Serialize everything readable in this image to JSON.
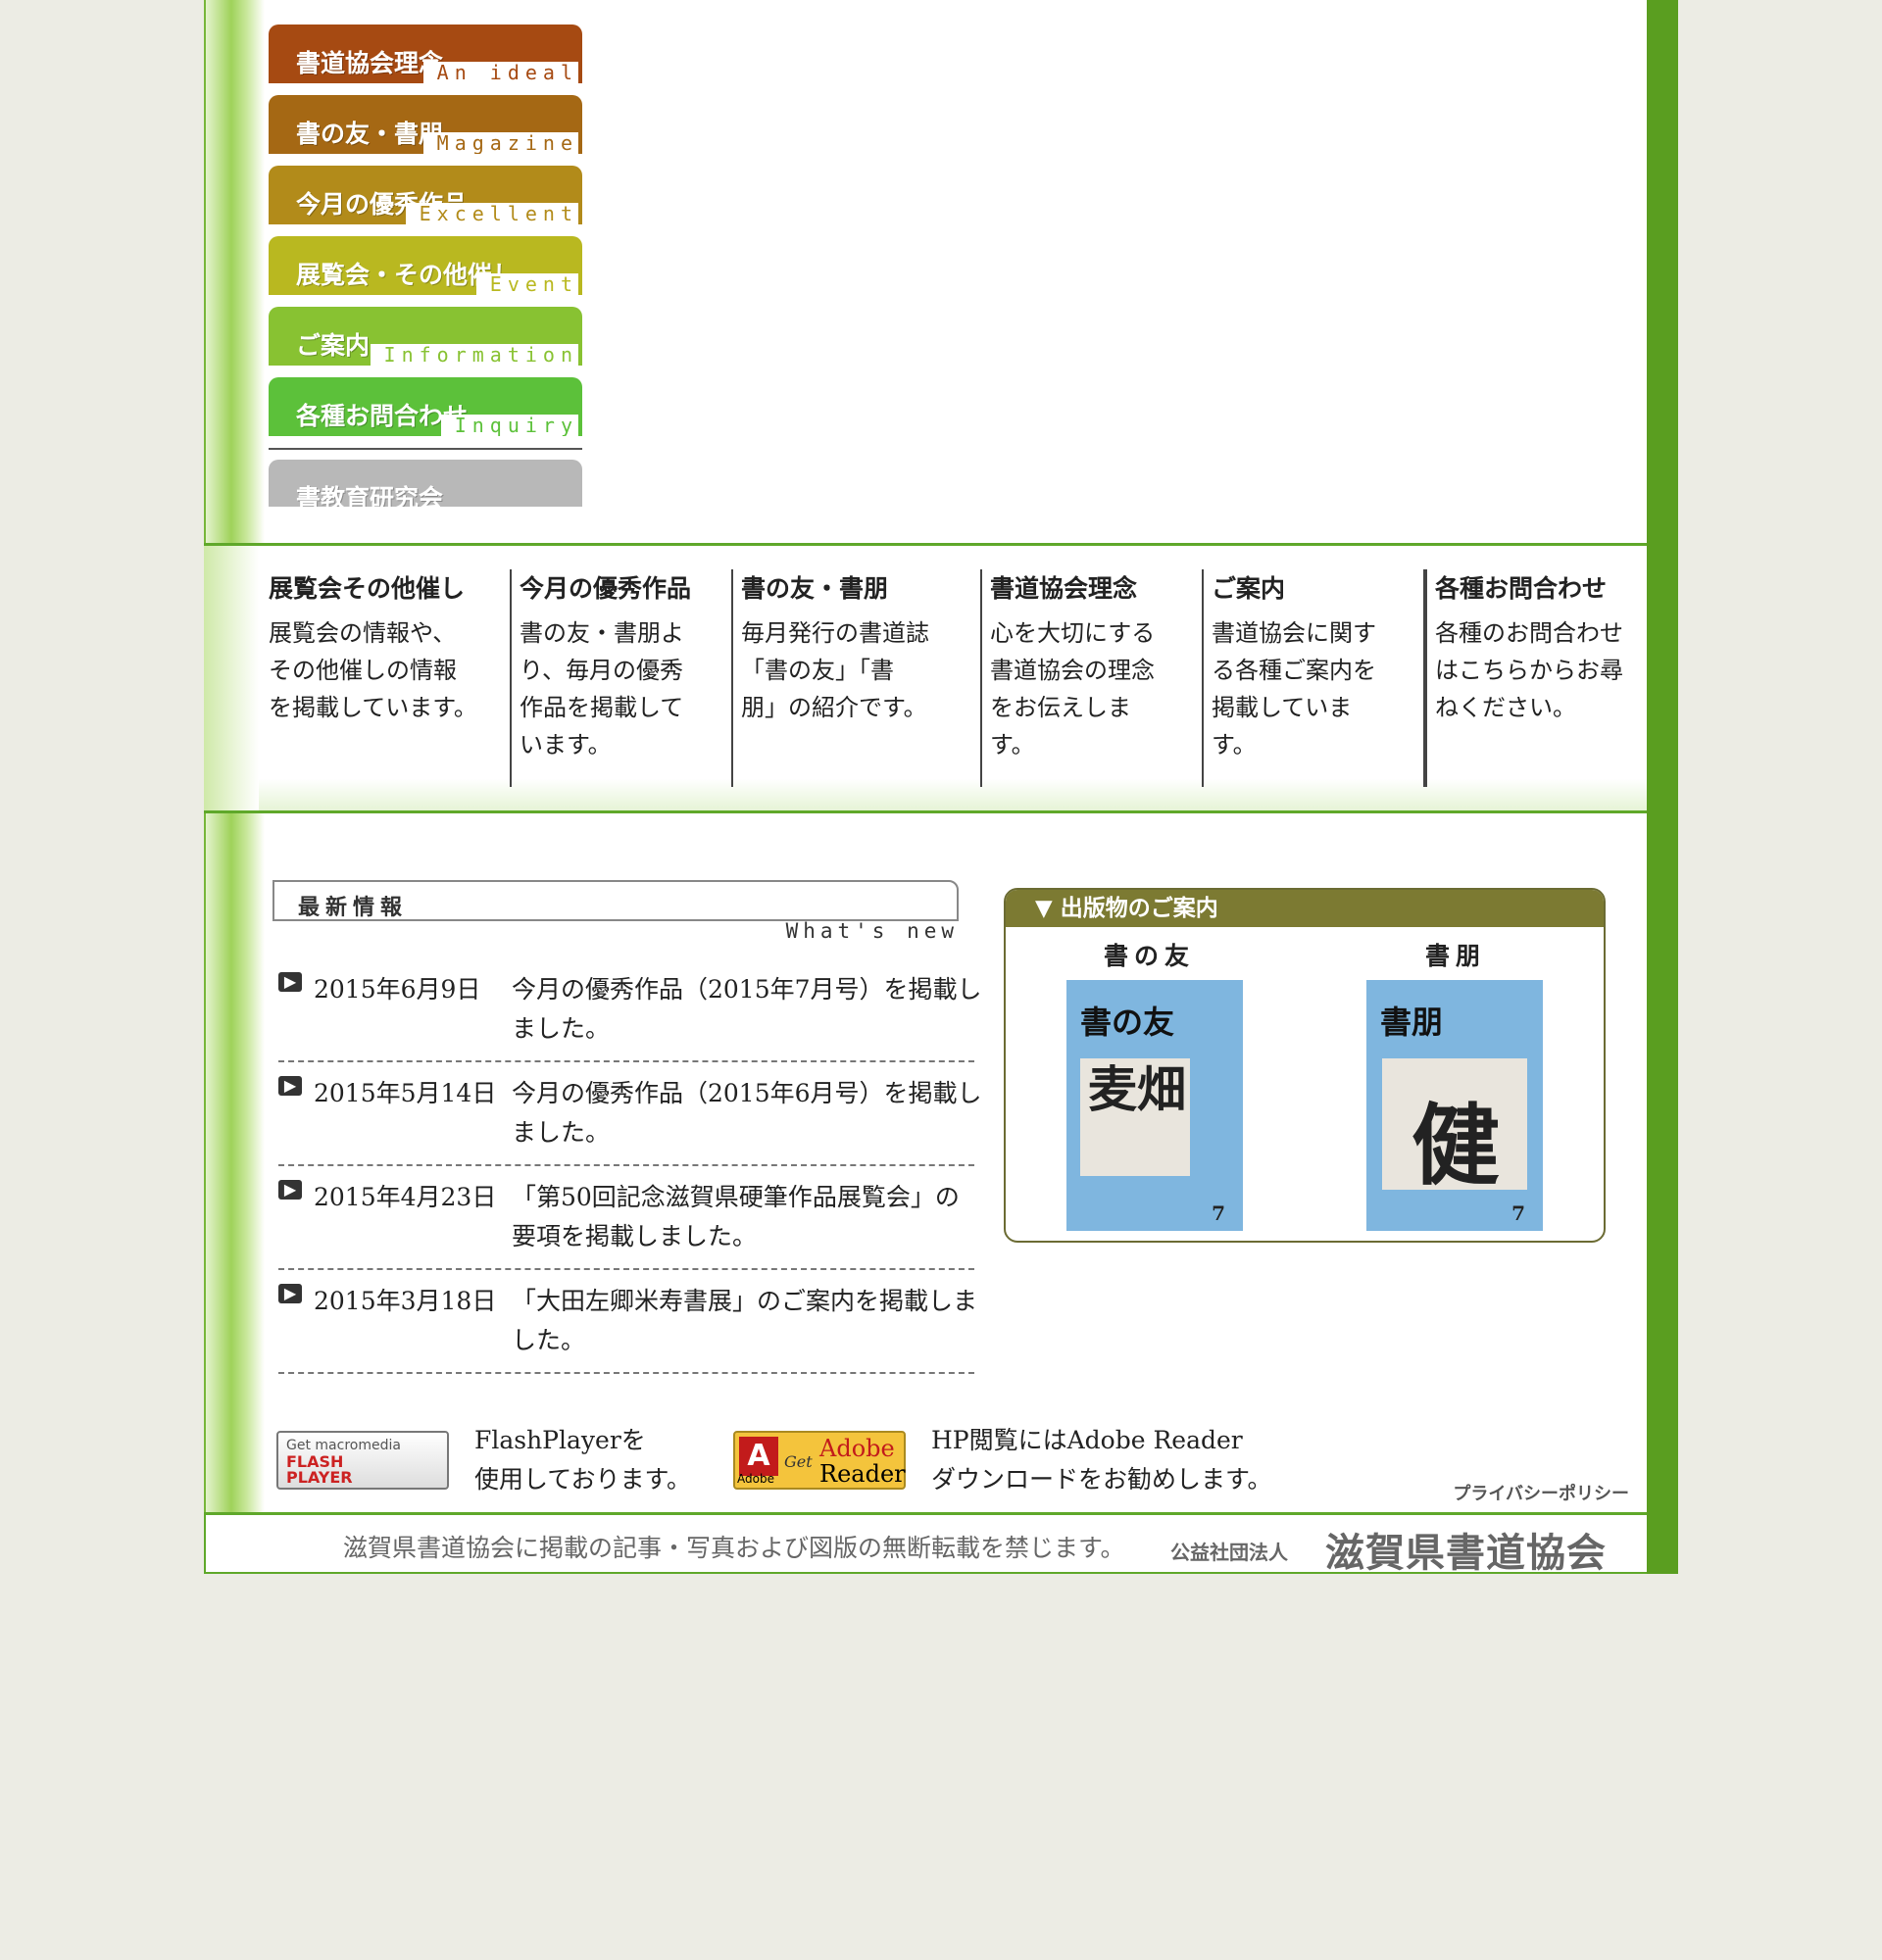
{
  "nav": {
    "items": [
      {
        "jp": "書道協会理念",
        "en": "An ideal",
        "color": "#a64a12"
      },
      {
        "jp": "書の友・書朋",
        "en": "Magazine",
        "color": "#a56814"
      },
      {
        "jp": "今月の優秀作品",
        "en": "Excellent",
        "color": "#b28b1a"
      },
      {
        "jp": "展覧会・その他催し",
        "en": "Event",
        "color": "#b9b820"
      },
      {
        "jp": "ご案内",
        "en": "Information",
        "color": "#88c232"
      },
      {
        "jp": "各種お問合わせ",
        "en": "Inquiry",
        "color": "#5cc13a"
      }
    ],
    "extra": {
      "jp": "書教育研究会",
      "color": "#b8b8b8"
    }
  },
  "categories": [
    {
      "title": "展覧会その他催し",
      "desc": "展覧会の情報や、\nその他催しの情報\nを掲載しています。"
    },
    {
      "title": "今月の優秀作品",
      "desc": "書の友・書朋よ\nり、毎月の優秀\n作品を掲載して\nいます。"
    },
    {
      "title": "書の友・書朋",
      "desc": "毎月発行の書道誌\n「書の友」「書\n朋」の紹介です。"
    },
    {
      "title": "書道協会理念",
      "desc": "心を大切にする\n書道協会の理念\nをお伝えしま\nす。"
    },
    {
      "title": "ご案内",
      "desc": "書道協会に関す\nる各種ご案内を\n掲載していま\nす。"
    },
    {
      "title": "各種お問合わせ",
      "desc": "各種のお問合わせ\nはこちらからお尋\nねください。"
    }
  ],
  "news": {
    "title": "最新情報",
    "subtitle": "What's new",
    "items": [
      {
        "date": "2015年6月9日",
        "text": "今月の優秀作品（2015年7月号）を掲載しました。"
      },
      {
        "date": "2015年5月14日",
        "text": "今月の優秀作品（2015年6月号）を掲載しました。"
      },
      {
        "date": "2015年4月23日",
        "text": "「第50回記念滋賀県硬筆作品展覧会」の要項を掲載しました。"
      },
      {
        "date": "2015年3月18日",
        "text": "「大田左卿米寿書展」のご案内を掲載しました。"
      }
    ]
  },
  "publications": {
    "header": "▼ 出版物のご案内",
    "items": [
      {
        "name": "書の友",
        "cover_title": "書の友",
        "cover_glyph": "麦畑",
        "issue": "7"
      },
      {
        "name": "書朋",
        "cover_title": "書朋",
        "cover_glyph": "健",
        "issue": "7"
      }
    ]
  },
  "downloads": {
    "flash": {
      "badge_l1": "Get macromedia",
      "badge_l2": "FLASH",
      "badge_l3": "PLAYER",
      "text1": "FlashPlayerを",
      "text2": "使用しております。"
    },
    "adobe": {
      "logo": "A",
      "logo_sub": "Adobe",
      "get": "Get",
      "r1": "Adobe",
      "r2": "Reader",
      "text1": "HP閲覧にはAdobe Reader",
      "text2": "ダウンロードをお勧めします。"
    }
  },
  "privacy_label": "プライバシーポリシー",
  "footer": {
    "notice": "滋賀県書道協会に掲載の記事・写真および図版の無断転載を禁じます。",
    "org_type": "公益社団法人",
    "org_name": "滋賀県書道協会"
  }
}
